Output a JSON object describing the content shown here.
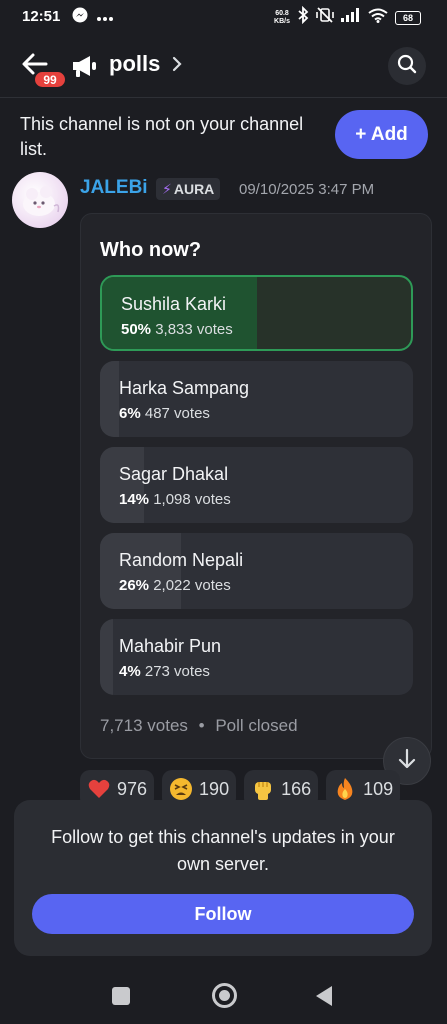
{
  "status_bar": {
    "time": "12:51",
    "net_speed_value": "60.8",
    "net_speed_unit": "KB/s",
    "battery": "68"
  },
  "header": {
    "back_badge": "99",
    "channel_name": "polls"
  },
  "notice": {
    "text": "This channel is not on your channel list.",
    "add_label": "+ Add"
  },
  "message": {
    "author": "JALEBi",
    "tag": "AURA",
    "timestamp": "09/10/2025 3:47 PM"
  },
  "poll": {
    "question": "Who now?",
    "options": [
      {
        "label": "Sushila Karki",
        "percent": "50%",
        "votes": "3,833 votes",
        "fraction": 0.5,
        "selected": true
      },
      {
        "label": "Harka Sampang",
        "percent": "6%",
        "votes": "487 votes",
        "fraction": 0.06,
        "selected": false
      },
      {
        "label": "Sagar Dhakal",
        "percent": "14%",
        "votes": "1,098 votes",
        "fraction": 0.14,
        "selected": false
      },
      {
        "label": "Random Nepali",
        "percent": "26%",
        "votes": "2,022 votes",
        "fraction": 0.26,
        "selected": false
      },
      {
        "label": "Mahabir Pun",
        "percent": "4%",
        "votes": "273 votes",
        "fraction": 0.04,
        "selected": false
      }
    ],
    "total_votes": "7,713 votes",
    "separator": "•",
    "state": "Poll closed"
  },
  "reactions": [
    {
      "icon": "heart-icon",
      "count": "976",
      "color": "#e5413d"
    },
    {
      "icon": "tired-face-icon",
      "count": "190",
      "color": "#f5b82e"
    },
    {
      "icon": "raised-fist-icon",
      "count": "166",
      "color": "#f5c542"
    },
    {
      "icon": "fire-icon",
      "count": "109",
      "color": "#f7841f"
    }
  ],
  "follow": {
    "text": "Follow to get this channel's updates in your own server.",
    "button_label": "Follow"
  },
  "colors": {
    "background": "#1c1d22",
    "accent": "#5865f2",
    "selected_border": "#2e9a57",
    "author": "#3ba3e8"
  }
}
